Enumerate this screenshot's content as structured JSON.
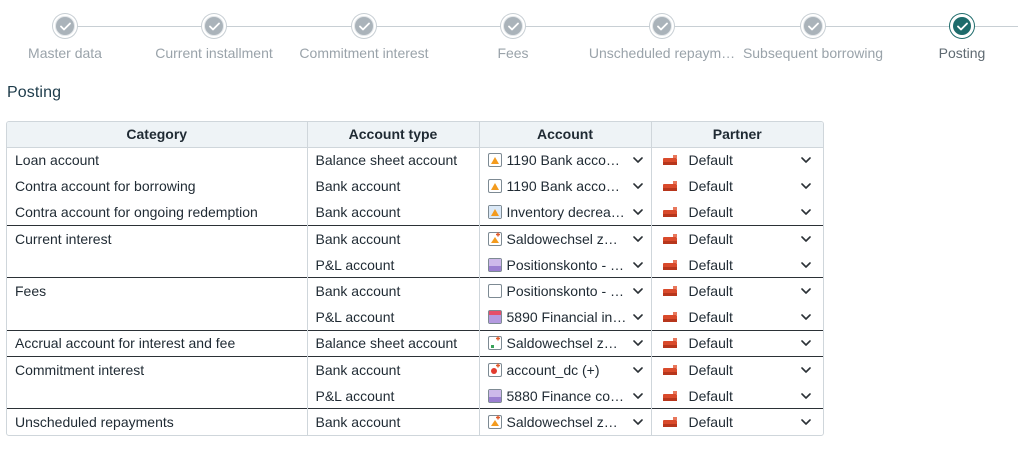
{
  "stepper": {
    "steps": [
      {
        "label": "Master data",
        "state": "done"
      },
      {
        "label": "Current installment",
        "state": "done"
      },
      {
        "label": "Commitment interest",
        "state": "done"
      },
      {
        "label": "Fees",
        "state": "done"
      },
      {
        "label": "Unscheduled repaym…",
        "state": "done"
      },
      {
        "label": "Subsequent borrowing",
        "state": "done"
      },
      {
        "label": "Posting",
        "state": "current"
      }
    ]
  },
  "section_title": "Posting",
  "table": {
    "headers": [
      "Category",
      "Account type",
      "Account",
      "Partner"
    ],
    "rows": [
      {
        "category": "Loan account",
        "account_type": "Balance sheet account",
        "account": "1190 Bank accou…",
        "account_icon": "orange-triangle",
        "partner": "Default",
        "group_start": true
      },
      {
        "category": "Contra account for borrowing",
        "account_type": "Bank account",
        "account": "1190 Bank accou…",
        "account_icon": "orange-triangle",
        "partner": "Default",
        "group_start": false
      },
      {
        "category": "Contra account for ongoing redemption",
        "account_type": "Bank account",
        "account": "Inventory decrea…",
        "account_icon": "blue-triangle",
        "partner": "Default",
        "group_start": false
      },
      {
        "category": "Current interest",
        "account_type": "Bank account",
        "account": "Saldowechsel zw…",
        "account_icon": "orange-plus",
        "partner": "Default",
        "group_start": true
      },
      {
        "category": "",
        "account_type": "P&L account",
        "account": "Positionskonto - …",
        "account_icon": "purple-gradient",
        "partner": "Default",
        "group_start": false
      },
      {
        "category": "Fees",
        "account_type": "Bank account",
        "account": "Positionskonto - …",
        "account_icon": "blank",
        "partner": "Default",
        "group_start": true
      },
      {
        "category": "",
        "account_type": "P&L account",
        "account": "5890 Financial in…",
        "account_icon": "red-purple-gradient",
        "partner": "Default",
        "group_start": false
      },
      {
        "category": "Accrual account for interest and fee",
        "account_type": "Balance sheet account",
        "account": "Saldowechsel zw…",
        "account_icon": "green-plus",
        "partner": "Default",
        "group_start": true
      },
      {
        "category": "Commitment interest",
        "account_type": "Bank account",
        "account": "account_dc (+)",
        "account_icon": "red-dot-plus",
        "partner": "Default",
        "group_start": true
      },
      {
        "category": "",
        "account_type": "P&L account",
        "account": "5880 Finance co…",
        "account_icon": "purple-gradient",
        "partner": "Default",
        "group_start": false
      },
      {
        "category": "Unscheduled repayments",
        "account_type": "Bank account",
        "account": "Saldowechsel zw…",
        "account_icon": "orange-plus",
        "partner": "Default",
        "group_start": true
      }
    ]
  },
  "colors": {
    "accent": "#1d6b6b",
    "step_done": "#aab3ba",
    "header_bg": "#eef3f6",
    "partner_icon": "#d94a2b"
  }
}
